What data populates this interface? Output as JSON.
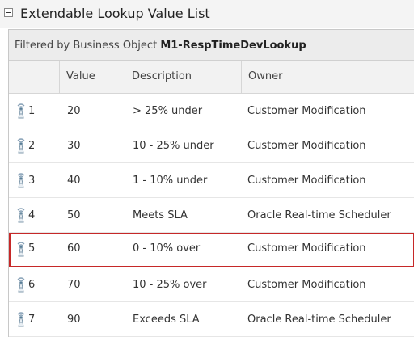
{
  "panel": {
    "title": "Extendable Lookup Value List"
  },
  "filter": {
    "prefix": "Filtered by Business Object",
    "business_object": "M1-RespTimeDevLookup"
  },
  "columns": {
    "value": "Value",
    "description": "Description",
    "owner": "Owner"
  },
  "rows": [
    {
      "num": "1",
      "value": "20",
      "description": "> 25% under",
      "owner": "Customer Modification",
      "highlighted": false
    },
    {
      "num": "2",
      "value": "30",
      "description": "10 - 25% under",
      "owner": "Customer Modification",
      "highlighted": false
    },
    {
      "num": "3",
      "value": "40",
      "description": "1 - 10% under",
      "owner": "Customer Modification",
      "highlighted": false
    },
    {
      "num": "4",
      "value": "50",
      "description": "Meets SLA",
      "owner": "Oracle Real-time Scheduler",
      "highlighted": false
    },
    {
      "num": "5",
      "value": "60",
      "description": "0 - 10% over",
      "owner": "Customer Modification",
      "highlighted": true
    },
    {
      "num": "6",
      "value": "70",
      "description": "10 - 25% over",
      "owner": "Customer Modification",
      "highlighted": false
    },
    {
      "num": "7",
      "value": "90",
      "description": "Exceeds SLA",
      "owner": "Oracle Real-time Scheduler",
      "highlighted": false
    }
  ],
  "icons": {
    "row_icon": "broadcast-icon",
    "collapse": "collapse-toggle-icon"
  },
  "colors": {
    "highlight_border": "#c62828"
  }
}
